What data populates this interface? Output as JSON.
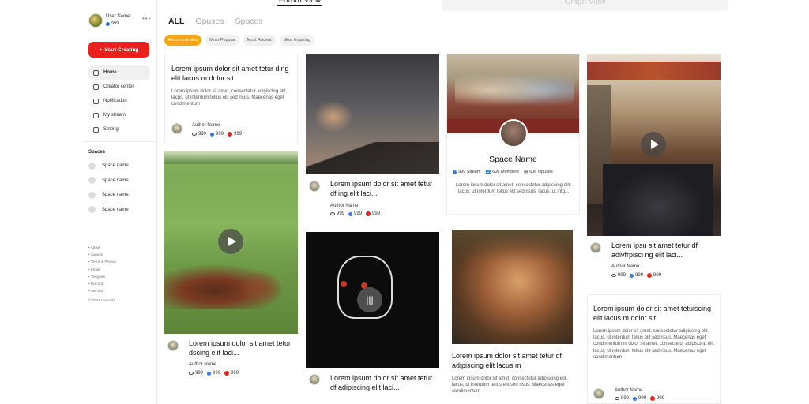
{
  "user": {
    "name": "User Name",
    "count": "999"
  },
  "sidebar": {
    "start_label": "Start Creating",
    "nav": [
      {
        "label": "Home",
        "icon": "home-icon"
      },
      {
        "label": "Creator center",
        "icon": "user-icon"
      },
      {
        "label": "Notification",
        "icon": "bell-icon"
      },
      {
        "label": "My stream",
        "icon": "stream-icon"
      },
      {
        "label": "Setting",
        "icon": "gear-icon"
      }
    ],
    "spaces_title": "Spaces",
    "spaces": [
      "Space name",
      "Space name",
      "Space name",
      "Space name"
    ],
    "footer": [
      "About",
      "Support",
      "Terms & Privacy",
      "Email",
      "Telegram",
      "Discord",
      "Wechat"
    ],
    "copyright": "© 2024 Cascad3"
  },
  "topbar": {
    "forum": "Forum View",
    "graph": "Graph View"
  },
  "tabs": [
    "ALL",
    "Opuses",
    "Spaces"
  ],
  "filters": [
    "Recommended",
    "Most Popular",
    "Most Recent",
    "Most Inspiring"
  ],
  "cards": {
    "c1": {
      "title": "Lorem ipsum dolor sit amet tetur ding elit lacus m dolor sit",
      "body": "Lorem ipsum dolor sit amet, consectetur adipiscing elit.  lacus, ut interdum tellus elit sed risus. Maecenas eget condimentum",
      "author": "Author Name",
      "views": "999",
      "shares": "999",
      "likes": "999"
    },
    "c2": {
      "title": "Lorem ipsum dolor sit amet tetur dscing elit laci...",
      "author": "Author Name",
      "views": "999",
      "shares": "999",
      "likes": "999"
    },
    "c3": {
      "title": "Lorem ipsum dolor sit amet tetur df ing elit laci...",
      "author": "Author Name",
      "views": "999",
      "shares": "999",
      "likes": "999"
    },
    "c4": {
      "title": "Lorem ipsum dolor sit amet tetur df adipiscing elit laci..."
    },
    "c5": {
      "space_name": "Space Name",
      "stream": "999 Stream",
      "members": "606 Members",
      "opuses": "606 Opuses",
      "body": "Lorem ipsum dolor sit amet, consectetur adipiscing elit.  lacus, ut interdum tellus elit sed risus.  lacus, ut intg..."
    },
    "c6": {
      "title": "Lorem ipsum dolor sit amet tetur df adipiscing elit lacus m",
      "body": "Lorem ipsum dolor sit amet, consectetur adipiscing elit.  lacus, ut interdum tellus elit sed risus. Maecenas eget condimentum"
    },
    "c7": {
      "title": "Lorem ipsu sit amet tetur df adivfrpisci ng elit laci...",
      "author": "Author Name",
      "views": "999",
      "shares": "999",
      "likes": "999"
    },
    "c8": {
      "title": "Lorem ipsum dolor sit amet tetuiscing elit lacus m dolor sit",
      "body": "Lorem ipsum dolor sit amet, consectetur adipiscing elit.  lacus, ut interdum tellus elit sed risus. Maecenas eget condimentum m dolor sit amet, consectetur adipiscing elit. lacus, ut interdum tellus elit sed risus. Maecenas eget condimentum",
      "author": "Author Name",
      "views": "999",
      "shares": "999",
      "likes": "999"
    }
  }
}
